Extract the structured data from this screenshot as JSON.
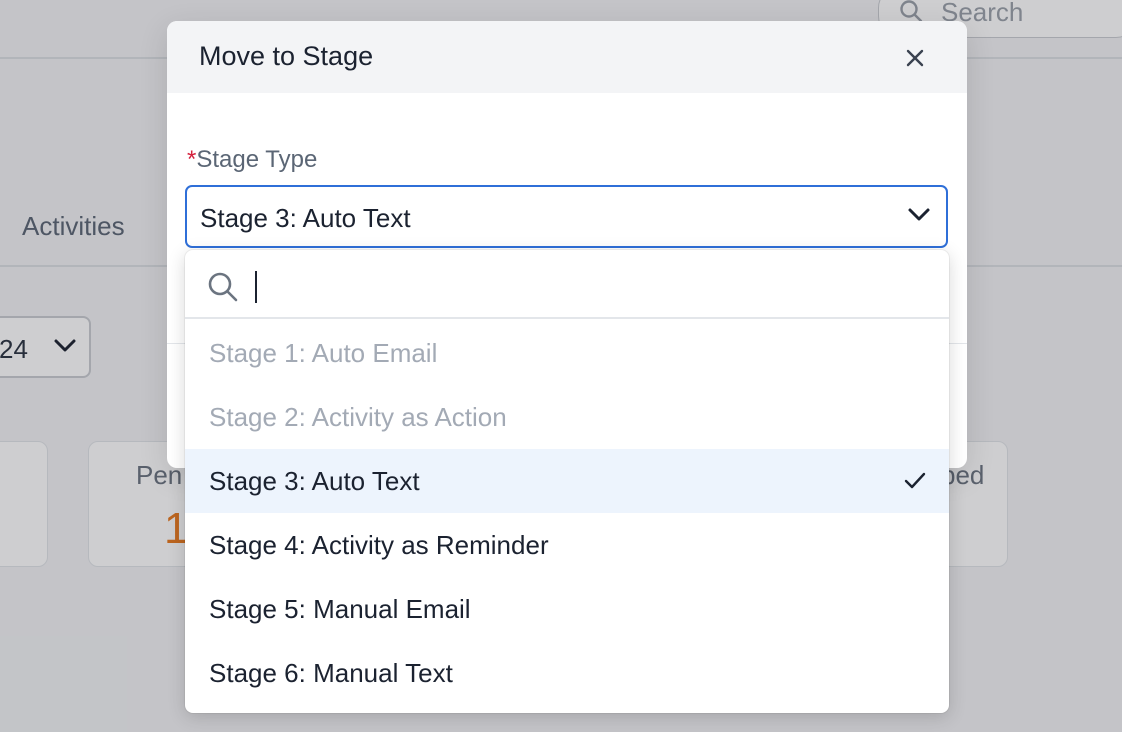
{
  "background": {
    "search_placeholder": "Search",
    "tab_activities": "Activities",
    "date_select_value": "24",
    "card_pending_label": "Pen",
    "card_pending_value": "1",
    "card_right_label": "bed"
  },
  "modal": {
    "title": "Move to Stage",
    "field": {
      "required_marker": "*",
      "label": "Stage Type",
      "value": "Stage 3: Auto Text"
    }
  },
  "dropdown": {
    "search_value": "",
    "options": [
      {
        "label": "Stage 1: Auto Email",
        "disabled": true,
        "selected": false
      },
      {
        "label": "Stage 2: Activity as Action",
        "disabled": true,
        "selected": false
      },
      {
        "label": "Stage 3: Auto Text",
        "disabled": false,
        "selected": true
      },
      {
        "label": "Stage 4: Activity as Reminder",
        "disabled": false,
        "selected": false
      },
      {
        "label": "Stage 5: Manual Email",
        "disabled": false,
        "selected": false
      },
      {
        "label": "Stage 6: Manual Text",
        "disabled": false,
        "selected": false
      }
    ]
  },
  "icons": {
    "close": "close-icon",
    "chevron": "chevron-down-icon",
    "search": "search-icon",
    "check": "checkmark-icon"
  },
  "colors": {
    "accent_border": "#2f6fd8",
    "required": "#d4213d",
    "selected_bg": "#edf4fd",
    "disabled_text": "#a3aab5",
    "pending_number": "#e8791d"
  }
}
